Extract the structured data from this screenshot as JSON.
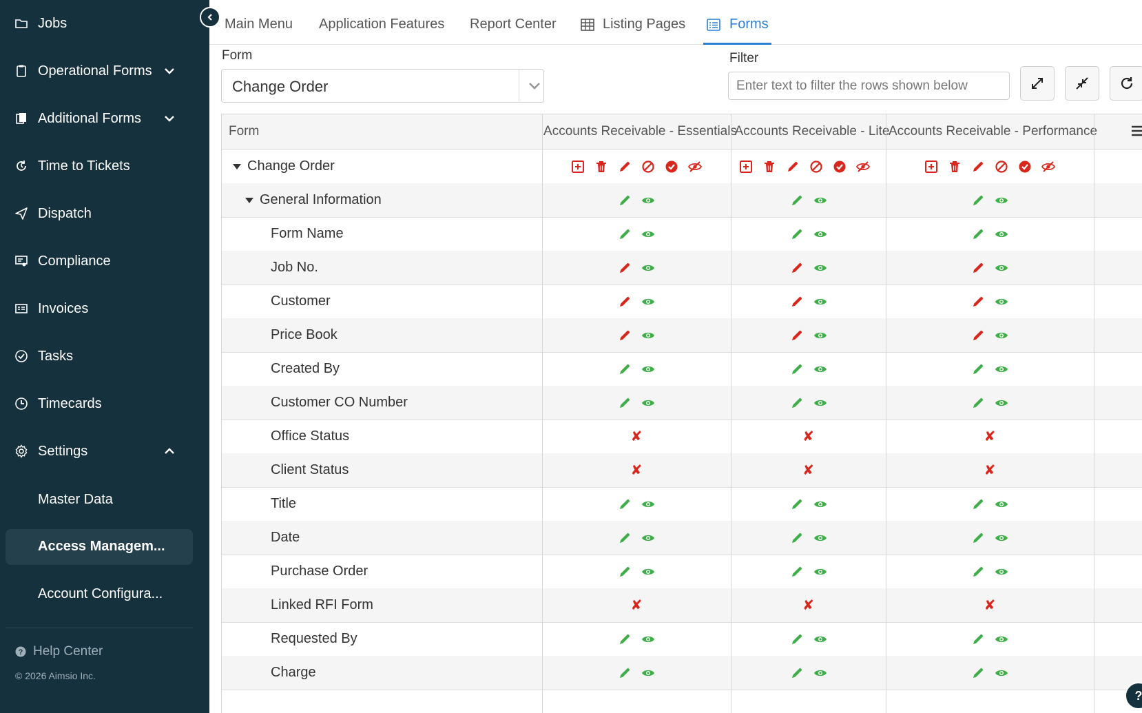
{
  "sidebar": {
    "items": [
      {
        "label": "Jobs",
        "icon": "folder-icon"
      },
      {
        "label": "Operational Forms",
        "icon": "clipboard-icon",
        "expandable": true
      },
      {
        "label": "Additional Forms",
        "icon": "documents-icon",
        "expandable": true
      },
      {
        "label": "Time to Tickets",
        "icon": "time-convert-icon"
      },
      {
        "label": "Dispatch",
        "icon": "paper-plane-icon"
      },
      {
        "label": "Compliance",
        "icon": "monitor-certificate-icon"
      },
      {
        "label": "Invoices",
        "icon": "invoice-icon"
      },
      {
        "label": "Tasks",
        "icon": "check-circle-icon"
      },
      {
        "label": "Timecards",
        "icon": "clock-icon"
      },
      {
        "label": "Settings",
        "icon": "gear-icon",
        "expanded": true
      }
    ],
    "settings_children": [
      {
        "label": "Master Data",
        "active": false
      },
      {
        "label": "Access Managem...",
        "active": true
      },
      {
        "label": "Account Configura...",
        "active": false
      }
    ],
    "help": "Help Center",
    "copyright": "© 2026 Aimsio Inc."
  },
  "tabs": [
    {
      "label": "Main Menu",
      "active": false
    },
    {
      "label": "Application Features",
      "active": false
    },
    {
      "label": "Report Center",
      "active": false
    },
    {
      "label": "Listing Pages",
      "active": false,
      "icon": "table-icon"
    },
    {
      "label": "Forms",
      "active": true,
      "icon": "form-list-icon"
    }
  ],
  "form_selector": {
    "label": "Form",
    "value": "Change Order"
  },
  "filter": {
    "label": "Filter",
    "placeholder": "Enter text to filter the rows shown below"
  },
  "tools": [
    "expand-all-icon",
    "collapse-all-icon",
    "refresh-icon"
  ],
  "grid": {
    "columns": [
      "Form",
      "Accounts Receivable - Essentials",
      "Accounts Receivable - Lite",
      "Accounts Receivable - Performance"
    ],
    "rows": [
      {
        "label": "Change Order",
        "level": 0,
        "toggle": true,
        "perm": "full"
      },
      {
        "label": "General Information",
        "level": 1,
        "toggle": true,
        "perm": "edit-view"
      },
      {
        "label": "Form Name",
        "level": 2,
        "perm": "edit-view"
      },
      {
        "label": "Job No.",
        "level": 2,
        "perm": "required-view"
      },
      {
        "label": "Customer",
        "level": 2,
        "perm": "required-view"
      },
      {
        "label": "Price Book",
        "level": 2,
        "perm": "required-view"
      },
      {
        "label": "Created By",
        "level": 2,
        "perm": "edit-view"
      },
      {
        "label": "Customer CO Number",
        "level": 2,
        "perm": "edit-view"
      },
      {
        "label": "Office Status",
        "level": 2,
        "perm": "none"
      },
      {
        "label": "Client Status",
        "level": 2,
        "perm": "none"
      },
      {
        "label": "Title",
        "level": 2,
        "perm": "edit-view"
      },
      {
        "label": "Date",
        "level": 2,
        "perm": "edit-view"
      },
      {
        "label": "Purchase Order",
        "level": 2,
        "perm": "edit-view"
      },
      {
        "label": "Linked RFI Form",
        "level": 2,
        "perm": "none"
      },
      {
        "label": "Requested By",
        "level": 2,
        "perm": "edit-view"
      },
      {
        "label": "Charge",
        "level": 2,
        "perm": "edit-view"
      }
    ]
  },
  "colors": {
    "sidebar_bg": "#15313d",
    "accent": "#2a7fd4",
    "green": "#3fae49",
    "red": "#d9261c"
  }
}
